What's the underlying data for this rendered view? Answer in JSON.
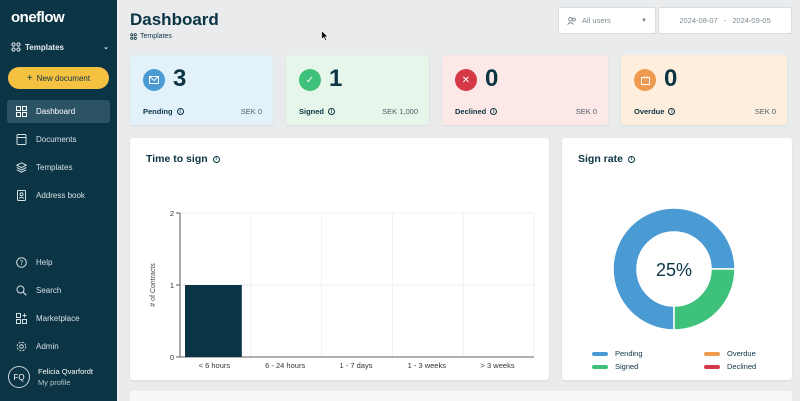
{
  "sidebar": {
    "logo": "oneflow",
    "workspace": "Templates",
    "new_document": "New document",
    "nav": [
      {
        "label": "Dashboard",
        "icon": "grid-icon",
        "active": true
      },
      {
        "label": "Documents",
        "icon": "document-icon",
        "active": false
      },
      {
        "label": "Templates",
        "icon": "layers-icon",
        "active": false
      },
      {
        "label": "Address book",
        "icon": "address-book-icon",
        "active": false
      }
    ],
    "nav_bottom": [
      {
        "label": "Help",
        "icon": "help-icon"
      },
      {
        "label": "Search",
        "icon": "search-icon"
      },
      {
        "label": "Marketplace",
        "icon": "marketplace-icon"
      },
      {
        "label": "Admin",
        "icon": "gear-icon"
      }
    ],
    "user": {
      "initials": "FQ",
      "name": "Felicia Qvarfordt",
      "sub": "My profile"
    }
  },
  "header": {
    "title": "Dashboard",
    "breadcrumb": "Templates",
    "users_filter": "All users",
    "date_from": "2024-08-07",
    "date_sep": "-",
    "date_to": "2024-09-05"
  },
  "stats": [
    {
      "label": "Pending",
      "count": "3",
      "amount": "SEK 0",
      "color": "#4a9bd4",
      "bg": "#e3f1fb",
      "icon": "mail-icon",
      "glyph": "✉"
    },
    {
      "label": "Signed",
      "count": "1",
      "amount": "SEK 1,000",
      "color": "#3ec17a",
      "bg": "#e6f6ea",
      "icon": "check-icon",
      "glyph": "✓"
    },
    {
      "label": "Declined",
      "count": "0",
      "amount": "SEK 0",
      "color": "#d33a45",
      "bg": "#fce8e6",
      "icon": "close-icon",
      "glyph": "✕"
    },
    {
      "label": "Overdue",
      "count": "0",
      "amount": "SEK 0",
      "color": "#ef9a4e",
      "bg": "#fdeedd",
      "icon": "calendar-icon",
      "glyph": "▣"
    }
  ],
  "time_to_sign": {
    "title": "Time to sign",
    "chart_data": {
      "type": "bar",
      "categories": [
        "< 6 hours",
        "6 - 24 hours",
        "1 - 7 days",
        "1 - 3 weeks",
        "> 3 weeks"
      ],
      "values": [
        1,
        0,
        0,
        0,
        0
      ],
      "ylabel": "# of Contracts",
      "ylim": [
        0,
        2
      ],
      "yticks": [
        "0",
        "1",
        "2"
      ],
      "bar_color": "#0b3444",
      "grid": true
    }
  },
  "sign_rate": {
    "title": "Sign rate",
    "center_label": "25%",
    "chart_data": {
      "type": "pie",
      "categories": [
        "Pending",
        "Signed",
        "Overdue",
        "Declined"
      ],
      "values": [
        3,
        1,
        0,
        0
      ],
      "colors": [
        "#4a9bd4",
        "#3ec17a",
        "#ef9a4e",
        "#d33a45"
      ]
    },
    "legend": [
      {
        "label": "Pending",
        "color": "#4a9bd4"
      },
      {
        "label": "Overdue",
        "color": "#ef9a4e"
      },
      {
        "label": "Signed",
        "color": "#3ec17a"
      },
      {
        "label": "Declined",
        "color": "#d33a45"
      }
    ]
  }
}
